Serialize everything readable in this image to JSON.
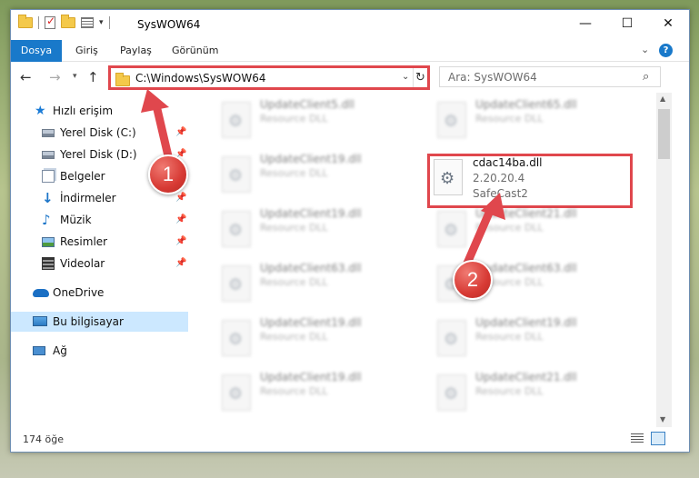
{
  "window": {
    "title": "SysWOW64",
    "controls": {
      "minimize": "—",
      "maximize": "☐",
      "close": "✕"
    }
  },
  "ribbon": {
    "tabs": [
      "Dosya",
      "Giriş",
      "Paylaş",
      "Görünüm"
    ],
    "help": "?"
  },
  "address": {
    "path": "C:\\Windows\\SysWOW64",
    "refresh_icon": "↻"
  },
  "search": {
    "placeholder": "Ara: SysWOW64",
    "icon": "search-icon"
  },
  "sidebar": {
    "items": [
      {
        "label": "Hızlı erişim",
        "icon": "star-icon"
      },
      {
        "label": "Yerel Disk (C:)",
        "icon": "drive-icon",
        "pinned": true
      },
      {
        "label": "Yerel Disk (D:)",
        "icon": "drive-icon",
        "pinned": true
      },
      {
        "label": "Belgeler",
        "icon": "documents-icon",
        "pinned": true
      },
      {
        "label": "İndirmeler",
        "icon": "downloads-icon",
        "pinned": true
      },
      {
        "label": "Müzik",
        "icon": "music-icon",
        "pinned": true
      },
      {
        "label": "Resimler",
        "icon": "pictures-icon",
        "pinned": true
      },
      {
        "label": "Videolar",
        "icon": "videos-icon",
        "pinned": true
      },
      {
        "label": "OneDrive",
        "icon": "onedrive-icon"
      },
      {
        "label": "Bu bilgisayar",
        "icon": "this-pc-icon",
        "selected": true
      },
      {
        "label": "Ağ",
        "icon": "network-icon"
      }
    ]
  },
  "files": {
    "left": [
      {
        "name": "UpdateClient5.dll",
        "desc": "Resource DLL"
      },
      {
        "name": "UpdateClient19.dll",
        "desc": "Resource DLL"
      },
      {
        "name": "UpdateClient19.dll",
        "desc": "Resource DLL"
      },
      {
        "name": "UpdateClient63.dll",
        "desc": "Resource DLL"
      },
      {
        "name": "UpdateClient19.dll",
        "desc": "Resource DLL"
      },
      {
        "name": "UpdateClient19.dll",
        "desc": "Resource DLL"
      }
    ],
    "right": [
      {
        "name": "UpdateClient65.dll",
        "desc": "Resource DLL"
      },
      {
        "name": "cdac14ba.dll",
        "version": "2.20.20.4",
        "desc": "SafeCast2",
        "highlighted": true
      },
      {
        "name": "UpdateClient21.dll",
        "desc": "Resource DLL"
      },
      {
        "name": "UpdateClient63.dll",
        "desc": "Resource DLL"
      },
      {
        "name": "UpdateClient19.dll",
        "desc": "Resource DLL"
      },
      {
        "name": "UpdateClient21.dll",
        "desc": "Resource DLL"
      }
    ]
  },
  "status": {
    "item_count": "174 öğe"
  },
  "annotations": {
    "step1": "1",
    "step2": "2",
    "color": "#e0474d"
  }
}
